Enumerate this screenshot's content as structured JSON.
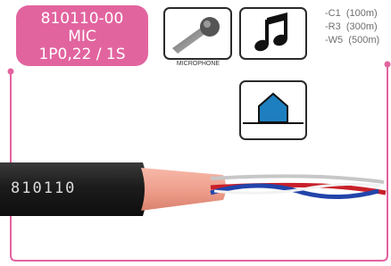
{
  "product": {
    "code": "810110-00",
    "type": "MIC",
    "spec": "1P0,22 / 1S"
  },
  "icons": {
    "application": {
      "icon": "microphone-icon",
      "label": "MICROPHONE"
    },
    "signal": {
      "icon": "music-note-icon"
    },
    "installation": {
      "icon": "house-icon"
    }
  },
  "variants": [
    {
      "code": "-C1",
      "length": "(100m)"
    },
    {
      "code": "-R3",
      "length": "(300m)"
    },
    {
      "code": "-W5",
      "length": "(500m)"
    }
  ],
  "cable": {
    "print": "810110"
  },
  "colors": {
    "accent": "#e2649f",
    "jacket": "#1c1c1c",
    "shield": "#f0a08e",
    "core_red": "#c8202a",
    "core_blue": "#2244aa",
    "house": "#1e7fc0"
  }
}
